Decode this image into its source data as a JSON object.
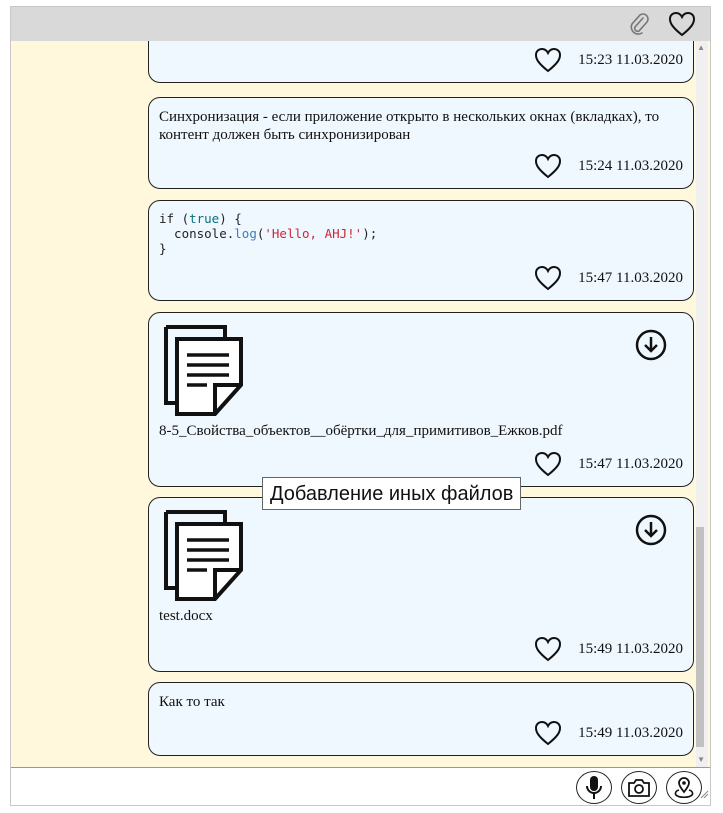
{
  "topbar": {
    "attach_icon": "paperclip-icon",
    "favorites_icon": "heart-icon"
  },
  "messages": [
    {
      "type": "text",
      "text": "",
      "time": "15:23 11.03.2020"
    },
    {
      "type": "text",
      "text": "Синхронизация - если приложение открыто в нескольких окнах (вкладках), то контент должен быть синхронизирован",
      "time": "15:24 11.03.2020"
    },
    {
      "type": "code",
      "code_lines": [
        "if (true) {",
        "  console.log('Hello, AHJ!');",
        "}"
      ],
      "time": "15:47 11.03.2020"
    },
    {
      "type": "file",
      "file_name": "8-5_Свойства_объектов__обёртки_для_примитивов_Ежков.pdf",
      "time": "15:47 11.03.2020"
    },
    {
      "type": "file",
      "file_name": "test.docx",
      "time": "15:49 11.03.2020"
    },
    {
      "type": "text",
      "text": "Как то так",
      "time": "15:49 11.03.2020"
    }
  ],
  "tooltip": {
    "text": "Добавление иных файлов"
  },
  "input": {
    "value": "",
    "placeholder": ""
  },
  "input_buttons": [
    "microphone-icon",
    "camera-icon",
    "geolocation-icon"
  ],
  "colors": {
    "chat_background": "#fff8dc",
    "message_background": "#f0f8ff",
    "topbar_background": "#d9d9d9"
  }
}
